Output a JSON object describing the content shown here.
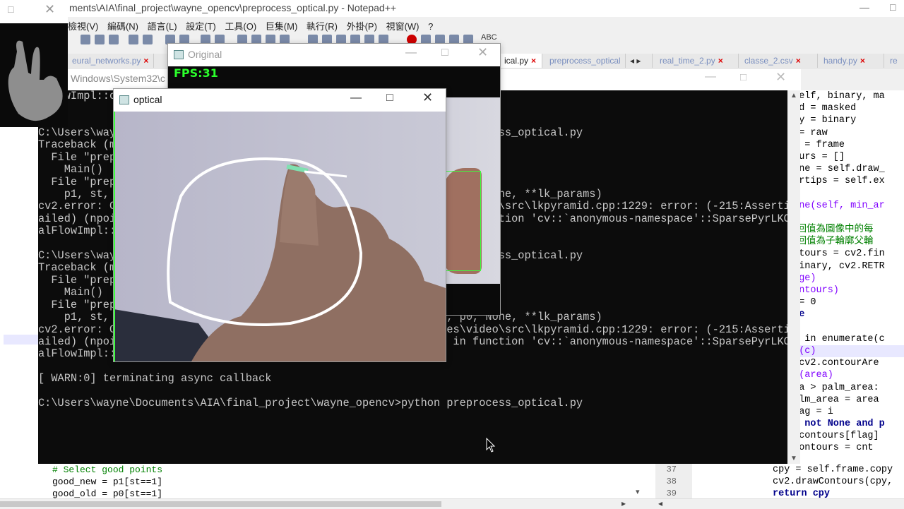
{
  "npp": {
    "title": "ments\\AIA\\final_project\\wayne_opencv\\preprocess_optical.py - Notepad++",
    "menu": [
      "檢視(V)",
      "編碼(N)",
      "語言(L)",
      "設定(T)",
      "工具(O)",
      "巨集(M)",
      "執行(R)",
      "外掛(P)",
      "視窗(W)",
      "?"
    ],
    "tabs": [
      "eural_networks.py",
      "ical.py",
      "preprocess_optical",
      "real_time_2.py",
      "classe_2.csv",
      "handy.py",
      "re"
    ],
    "right_code": [
      {
        "t": "(self, binary, ma",
        "c": ""
      },
      {
        "t": "ked = masked",
        "c": ""
      },
      {
        "t": "ary = binary",
        "c": ""
      },
      {
        "t": "w = raw",
        "c": ""
      },
      {
        "t": "me = frame",
        "c": ""
      },
      {
        "t": "tours = []",
        "c": ""
      },
      {
        "t": "line = self.draw_",
        "c": ""
      },
      {
        "t": "gertips = self.ex",
        "c": ""
      },
      {
        "t": "",
        "c": ""
      },
      {
        "t": "line(self, min_ar",
        "c": "fn"
      },
      {
        "t": "",
        "c": ""
      },
      {
        "t": "返回值為圖像中的每",
        "c": "cm"
      },
      {
        "t": "返回值為子輪廓父輪",
        "c": "cm"
      },
      {
        "t": "ontours = cv2.fin",
        "c": ""
      },
      {
        "t": ".binary, cv2.RETR",
        "c": ""
      },
      {
        "t": "mage)",
        "c": "fn"
      },
      {
        "t": "ountours)",
        "c": "fn"
      },
      {
        "t": "a = 0",
        "c": ""
      },
      {
        "t": "one",
        "c": "kw"
      },
      {
        "t": "ne",
        "c": "kw"
      },
      {
        "t": "c) in enumerate(c",
        "c": ""
      },
      {
        "t": "nt(c)",
        "c": "fn"
      },
      {
        "t": "= cv2.contourAre",
        "c": ""
      },
      {
        "t": "nt(area)",
        "c": "fn"
      },
      {
        "t": "rea > palm_area:",
        "c": ""
      },
      {
        "t": "palm_area = area",
        "c": ""
      },
      {
        "t": "flag = i",
        "c": ""
      },
      {
        "t": "is not None and p",
        "c": "kw"
      },
      {
        "t": "= contours[flag]",
        "c": ""
      },
      {
        "t": ".contours = cnt",
        "c": ""
      }
    ],
    "bottom_code": [
      "# Select good points",
      "good_new = p1[st==1]",
      "good_old = p0[st==1]"
    ],
    "line_numbers": [
      "37",
      "38",
      "39"
    ],
    "bottom_right_code": [
      "cpy = self.frame.copy",
      "cv2.drawContours(cpy,",
      "return cpy"
    ],
    "left_path": "Windows\\System32\\c"
  },
  "console": {
    "lines": [
      "C:\\Users\\wayne\\Documents\\AIA\\final_project\\wayne_opencv>python preprocess_optical.py",
      "Traceback (most recent call last):",
      "  File \"preprocess_optical.py\"",
      "    Main()",
      "  File \"preprocess_optical.py\"",
      "    p1, st, err = cv2.calcOpticalFlowPyrLK(old_gray, frame_gray, p0, None, **lk_params)",
      "cv2.error: OpenCV(4.1.1) C:\\projects\\opencv-python\\opencv\\modules\\video\\src\\lkpyramid.cpp:1229: error: (-215:Assertion f",
      "ailed) (npoints = prevPtsMat.checkVector(2, CV_32F, true)) >= 0 in function 'cv::`anonymous-namespace'::SparsePyrLKOptic",
      "alFlowImpl::calc'",
      "",
      "C:\\Users\\wayne\\Documents\\AIA\\final_project\\wayne_opencv>python preprocess_optical.py",
      "Traceback (most recent call last):",
      "  File \"preprocess_optical.py\"",
      "    Main()",
      "  File \"preprocess_optical.py\"",
      "    p1, st, err = cv2.calcOpticalFlowPyrLK(old_gray, frame_gray, p0, None, **lk_params)",
      "cv2.error: OpenCV(4.1.1) C:\\projects\\opencv-python\\opencv\\modules\\video\\src\\lkpyramid.cpp:1229: error: (-215:Assertion f",
      "ailed) (npoints = prevPtsMat.checkVector(2, CV_32F, true)) >= 0 in function 'cv::`anonymous-namespace'::SparsePyrLKOptic",
      "alFlowImpl::calc'",
      "",
      "[ WARN:0] terminating async callback",
      "",
      "C:\\Users\\wayne\\Documents\\AIA\\final_project\\wayne_opencv>python preprocess_optical.py"
    ],
    "first_line": "lFlowImpl::c"
  },
  "windows": {
    "original_title": "Original",
    "fps": "FPS:31",
    "optical_title": "optical"
  },
  "icons": {
    "minimize": "minimize-icon",
    "maximize": "maximize-icon",
    "close": "close-icon"
  }
}
